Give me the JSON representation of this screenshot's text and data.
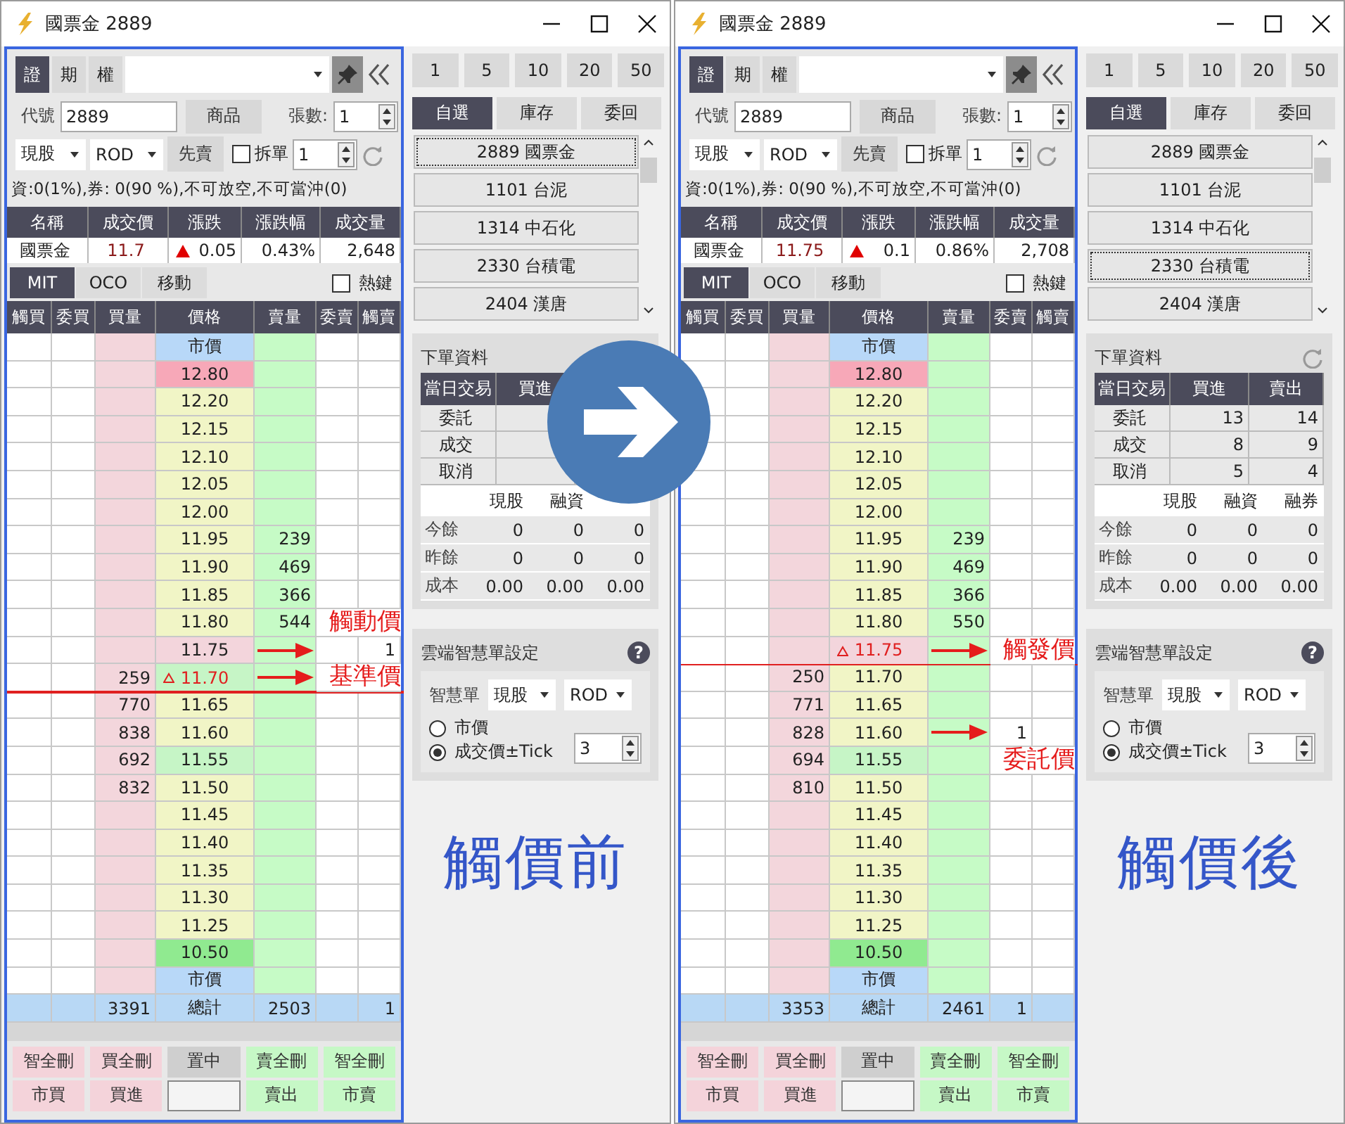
{
  "windows": [
    {
      "title": "國票金 2889",
      "market_tabs": [
        {
          "label": "證",
          "selected": true
        },
        {
          "label": "期",
          "selected": false
        },
        {
          "label": "權",
          "selected": false
        }
      ],
      "code_label": "代號",
      "code": "2889",
      "product_button": "商品",
      "qty_label": "張數:",
      "qty": "1",
      "order_type": "現股",
      "time_in_force": "ROD",
      "sell_first_button": "先賣",
      "split": {
        "label": "拆單",
        "checked": false
      },
      "split_qty": "1",
      "info": "資:0(1%),券: 0(90 %),不可放空,不可當沖(0)",
      "quote": {
        "columns": [
          "名稱",
          "成交價",
          "漲跌",
          "漲跌幅",
          "成交量"
        ],
        "name": "國票金",
        "price": "11.7",
        "rising": true,
        "change": "0.05",
        "change_pct": "0.43%",
        "volume": "2,648"
      },
      "order_tabs": [
        {
          "label": "MIT",
          "selected": true
        },
        {
          "label": "OCO",
          "selected": false
        },
        {
          "label": "移動",
          "selected": false
        }
      ],
      "hotkey": {
        "label": "熱鍵",
        "checked": false
      },
      "ladder": {
        "columns": [
          "觸買",
          "委買",
          "買量",
          "價格",
          "賣量",
          "委賣",
          "觸賣"
        ],
        "rows": [
          {
            "price": "市價",
            "color": "#b8d8f8",
            "last": false,
            "arrow": false
          },
          {
            "price": "12.80",
            "color": "#f7a8b8",
            "last": false,
            "arrow": false
          },
          {
            "price": "12.20",
            "color": "#f1f5c6",
            "last": false,
            "arrow": false
          },
          {
            "price": "12.15",
            "color": "#f1f5c6",
            "last": false,
            "arrow": false
          },
          {
            "price": "12.10",
            "color": "#f1f5c6",
            "last": false,
            "arrow": false
          },
          {
            "price": "12.05",
            "color": "#f1f5c6",
            "last": false,
            "arrow": false
          },
          {
            "price": "12.00",
            "color": "#f1f5c6",
            "last": false,
            "arrow": false
          },
          {
            "price": "11.95",
            "ask": "239",
            "color": "#f1f5c6",
            "last": false,
            "arrow": false
          },
          {
            "price": "11.90",
            "ask": "469",
            "color": "#f1f5c6",
            "last": false,
            "arrow": false
          },
          {
            "price": "11.85",
            "ask": "366",
            "color": "#f1f5c6",
            "last": false,
            "arrow": false
          },
          {
            "price": "11.80",
            "ask": "544",
            "color": "#f1f5c6",
            "last": false,
            "arrow": false,
            "note": "觸動價"
          },
          {
            "price": "11.75",
            "trigger_sell": "1",
            "color": "#f3d5dc",
            "last": false,
            "arrow": true
          },
          {
            "bid": "259",
            "price": "11.70",
            "color": "#c6f5c6",
            "last": true,
            "arrow": true,
            "note": "基準價"
          },
          {
            "bid": "770",
            "price": "11.65",
            "color": "#f1f5c6",
            "last": false,
            "arrow": false
          },
          {
            "bid": "838",
            "price": "11.60",
            "color": "#f1f5c6",
            "last": false,
            "arrow": false
          },
          {
            "bid": "692",
            "price": "11.55",
            "color": "#c6f5c6",
            "last": false,
            "arrow": false
          },
          {
            "bid": "832",
            "price": "11.50",
            "color": "#f1f5c6",
            "last": false,
            "arrow": false
          },
          {
            "price": "11.45",
            "color": "#f1f5c6",
            "last": false,
            "arrow": false
          },
          {
            "price": "11.40",
            "color": "#f1f5c6",
            "last": false,
            "arrow": false
          },
          {
            "price": "11.35",
            "color": "#f1f5c6",
            "last": false,
            "arrow": false
          },
          {
            "price": "11.30",
            "color": "#f1f5c6",
            "last": false,
            "arrow": false
          },
          {
            "price": "11.25",
            "color": "#f1f5c6",
            "last": false,
            "arrow": false
          },
          {
            "price": "10.50",
            "color": "#90ea90",
            "last": false,
            "arrow": false
          },
          {
            "price": "市價",
            "color": "#b8d8f8",
            "last": false,
            "arrow": false
          }
        ],
        "total": {
          "bid": "3391",
          "price": "總計",
          "ask": "2503",
          "trigger_sell": "1"
        }
      },
      "bottom_buttons": [
        [
          {
            "label": "智全刪",
            "kind": "buy"
          },
          {
            "label": "買全刪",
            "kind": "buy"
          },
          {
            "label": "置中",
            "kind": "neutral"
          },
          {
            "label": "賣全刪",
            "kind": "sell"
          },
          {
            "label": "智全刪",
            "kind": "sell"
          }
        ],
        [
          {
            "label": "市買",
            "kind": "buy"
          },
          {
            "label": "買進",
            "kind": "buy"
          },
          {
            "kind": "field"
          },
          {
            "label": "賣出",
            "kind": "sell"
          },
          {
            "label": "市賣",
            "kind": "sell"
          }
        ]
      ],
      "qty_buttons": [
        "1",
        "5",
        "10",
        "20",
        "50"
      ],
      "list_tabs": [
        {
          "label": "自選",
          "selected": true
        },
        {
          "label": "庫存",
          "selected": false
        },
        {
          "label": "委回",
          "selected": false
        }
      ],
      "watchlist": [
        {
          "label": "2889 國票金",
          "selected": true
        },
        {
          "label": "1101 台泥",
          "selected": false
        },
        {
          "label": "1314 中石化",
          "selected": false
        },
        {
          "label": "2330 台積電",
          "selected": false
        },
        {
          "label": "2404 漢唐",
          "selected": false
        }
      ],
      "order_panel": {
        "title": "下單資料",
        "refresh_icon": false,
        "trade_columns": [
          "當日交易",
          "買進"
        ],
        "trade_rows": [
          {
            "label": "委託"
          },
          {
            "label": "成交"
          },
          {
            "label": "取消"
          }
        ],
        "position_columns": [
          "現股",
          "融資"
        ],
        "position_rows": [
          {
            "label": "今餘",
            "values": [
              "0",
              "0",
              "0"
            ]
          },
          {
            "label": "昨餘",
            "values": [
              "0",
              "0",
              "0"
            ]
          },
          {
            "label": "成本",
            "values": [
              "0.00",
              "0.00",
              "0.00"
            ]
          }
        ]
      },
      "smart_panel": {
        "title": "雲端智慧單設定",
        "help": "?",
        "order_label": "智慧單",
        "order_type": "現股",
        "time_in_force": "ROD",
        "price_options": [
          {
            "label": "市價",
            "selected": false
          },
          {
            "label": "成交價±Tick",
            "selected": true
          }
        ],
        "tick": "3"
      },
      "caption": "觸價前"
    },
    {
      "title": "國票金 2889",
      "market_tabs": [
        {
          "label": "證",
          "selected": true
        },
        {
          "label": "期",
          "selected": false
        },
        {
          "label": "權",
          "selected": false
        }
      ],
      "code_label": "代號",
      "code": "2889",
      "product_button": "商品",
      "qty_label": "張數:",
      "qty": "1",
      "order_type": "現股",
      "time_in_force": "ROD",
      "sell_first_button": "先賣",
      "split": {
        "label": "拆單",
        "checked": false
      },
      "split_qty": "1",
      "info": "資:0(1%),券: 0(90 %),不可放空,不可當沖(0)",
      "quote": {
        "columns": [
          "名稱",
          "成交價",
          "漲跌",
          "漲跌幅",
          "成交量"
        ],
        "name": "國票金",
        "price": "11.75",
        "rising": true,
        "change": "0.1",
        "change_pct": "0.86%",
        "volume": "2,708"
      },
      "order_tabs": [
        {
          "label": "MIT",
          "selected": true
        },
        {
          "label": "OCO",
          "selected": false
        },
        {
          "label": "移動",
          "selected": false
        }
      ],
      "hotkey": {
        "label": "熱鍵",
        "checked": false
      },
      "ladder": {
        "columns": [
          "觸買",
          "委買",
          "買量",
          "價格",
          "賣量",
          "委賣",
          "觸賣"
        ],
        "rows": [
          {
            "price": "市價",
            "color": "#b8d8f8",
            "last": false,
            "arrow": false
          },
          {
            "price": "12.80",
            "color": "#f7a8b8",
            "last": false,
            "arrow": false
          },
          {
            "price": "12.20",
            "color": "#f1f5c6",
            "last": false,
            "arrow": false
          },
          {
            "price": "12.15",
            "color": "#f1f5c6",
            "last": false,
            "arrow": false
          },
          {
            "price": "12.10",
            "color": "#f1f5c6",
            "last": false,
            "arrow": false
          },
          {
            "price": "12.05",
            "color": "#f1f5c6",
            "last": false,
            "arrow": false
          },
          {
            "price": "12.00",
            "color": "#f1f5c6",
            "last": false,
            "arrow": false
          },
          {
            "price": "11.95",
            "ask": "239",
            "color": "#f1f5c6",
            "last": false,
            "arrow": false
          },
          {
            "price": "11.90",
            "ask": "469",
            "color": "#f1f5c6",
            "last": false,
            "arrow": false
          },
          {
            "price": "11.85",
            "ask": "366",
            "color": "#f1f5c6",
            "last": false,
            "arrow": false
          },
          {
            "price": "11.80",
            "ask": "550",
            "color": "#f1f5c6",
            "last": false,
            "arrow": false
          },
          {
            "price": "11.75",
            "color": "#f3d5dc",
            "last": true,
            "arrow": true,
            "note": "觸發價"
          },
          {
            "bid": "250",
            "price": "11.70",
            "color": "#f1f5c6",
            "last": false,
            "arrow": false
          },
          {
            "bid": "771",
            "price": "11.65",
            "color": "#f1f5c6",
            "last": false,
            "arrow": false
          },
          {
            "bid": "828",
            "price": "11.60",
            "order_sell": "1",
            "color": "#f1f5c6",
            "last": false,
            "arrow": true
          },
          {
            "bid": "694",
            "price": "11.55",
            "color": "#c6f5c6",
            "last": false,
            "arrow": false,
            "note": "委託價"
          },
          {
            "bid": "810",
            "price": "11.50",
            "color": "#f1f5c6",
            "last": false,
            "arrow": false
          },
          {
            "price": "11.45",
            "color": "#f1f5c6",
            "last": false,
            "arrow": false
          },
          {
            "price": "11.40",
            "color": "#f1f5c6",
            "last": false,
            "arrow": false
          },
          {
            "price": "11.35",
            "color": "#f1f5c6",
            "last": false,
            "arrow": false
          },
          {
            "price": "11.30",
            "color": "#f1f5c6",
            "last": false,
            "arrow": false
          },
          {
            "price": "11.25",
            "color": "#f1f5c6",
            "last": false,
            "arrow": false
          },
          {
            "price": "10.50",
            "color": "#90ea90",
            "last": false,
            "arrow": false
          },
          {
            "price": "市價",
            "color": "#b8d8f8",
            "last": false,
            "arrow": false
          }
        ],
        "total": {
          "bid": "3353",
          "price": "總計",
          "ask": "2461",
          "order_sell": "1"
        }
      },
      "bottom_buttons": [
        [
          {
            "label": "智全刪",
            "kind": "buy"
          },
          {
            "label": "買全刪",
            "kind": "buy"
          },
          {
            "label": "置中",
            "kind": "neutral"
          },
          {
            "label": "賣全刪",
            "kind": "sell"
          },
          {
            "label": "智全刪",
            "kind": "sell"
          }
        ],
        [
          {
            "label": "市買",
            "kind": "buy"
          },
          {
            "label": "買進",
            "kind": "buy"
          },
          {
            "kind": "field"
          },
          {
            "label": "賣出",
            "kind": "sell"
          },
          {
            "label": "市賣",
            "kind": "sell"
          }
        ]
      ],
      "qty_buttons": [
        "1",
        "5",
        "10",
        "20",
        "50"
      ],
      "list_tabs": [
        {
          "label": "自選",
          "selected": true
        },
        {
          "label": "庫存",
          "selected": false
        },
        {
          "label": "委回",
          "selected": false
        }
      ],
      "watchlist": [
        {
          "label": "2889 國票金",
          "selected": false
        },
        {
          "label": "1101 台泥",
          "selected": false
        },
        {
          "label": "1314 中石化",
          "selected": false
        },
        {
          "label": "2330 台積電",
          "selected": true
        },
        {
          "label": "2404 漢唐",
          "selected": false
        }
      ],
      "order_panel": {
        "title": "下單資料",
        "refresh_icon": true,
        "trade_columns": [
          "當日交易",
          "買進",
          "賣出"
        ],
        "trade_rows": [
          {
            "label": "委託",
            "values": [
              "13",
              "14"
            ]
          },
          {
            "label": "成交",
            "values": [
              "8",
              "9"
            ]
          },
          {
            "label": "取消",
            "values": [
              "5",
              "4"
            ]
          }
        ],
        "position_columns": [
          "現股",
          "融資",
          "融券"
        ],
        "position_rows": [
          {
            "label": "今餘",
            "values": [
              "0",
              "0",
              "0"
            ]
          },
          {
            "label": "昨餘",
            "values": [
              "0",
              "0",
              "0"
            ]
          },
          {
            "label": "成本",
            "values": [
              "0.00",
              "0.00",
              "0.00"
            ]
          }
        ]
      },
      "smart_panel": {
        "title": "雲端智慧單設定",
        "help": "?",
        "order_label": "智慧單",
        "order_type": "現股",
        "time_in_force": "ROD",
        "price_options": [
          {
            "label": "市價",
            "selected": false
          },
          {
            "label": "成交價±Tick",
            "selected": true
          }
        ],
        "tick": "3"
      },
      "caption": "觸價後"
    }
  ]
}
